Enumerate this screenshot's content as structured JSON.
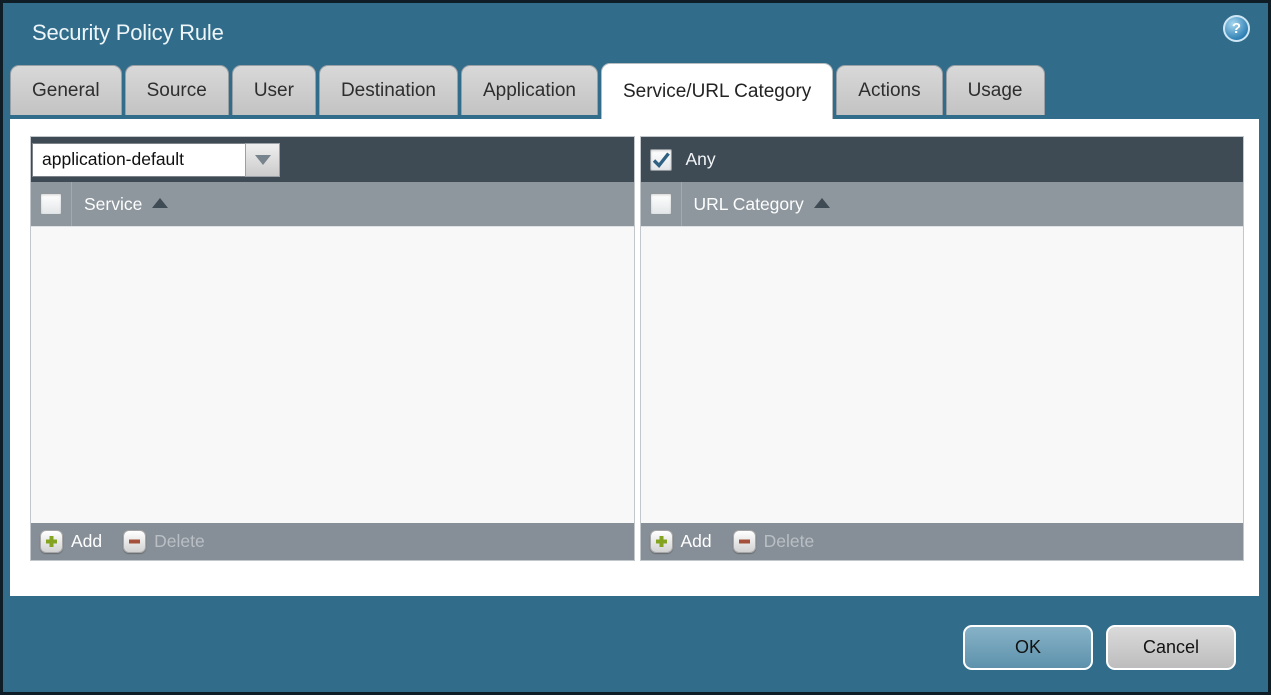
{
  "window": {
    "title": "Security Policy Rule",
    "help_glyph": "?"
  },
  "tabs": [
    {
      "label": "General",
      "active": false
    },
    {
      "label": "Source",
      "active": false
    },
    {
      "label": "User",
      "active": false
    },
    {
      "label": "Destination",
      "active": false
    },
    {
      "label": "Application",
      "active": false
    },
    {
      "label": "Service/URL Category",
      "active": true
    },
    {
      "label": "Actions",
      "active": false
    },
    {
      "label": "Usage",
      "active": false
    }
  ],
  "service_panel": {
    "dropdown_value": "application-default",
    "column_header": "Service",
    "rows": [],
    "header_checkbox_checked": false,
    "add_label": "Add",
    "delete_label": "Delete",
    "delete_enabled": false
  },
  "url_category_panel": {
    "any_label": "Any",
    "any_checked": true,
    "column_header": "URL Category",
    "rows": [],
    "header_checkbox_checked": false,
    "add_label": "Add",
    "delete_label": "Delete",
    "delete_enabled": false
  },
  "dialog_buttons": {
    "ok_label": "OK",
    "cancel_label": "Cancel"
  },
  "colors": {
    "window_background": "#316d8b",
    "window_border": "#0e1d26",
    "panel_header_dark": "#3e4a54",
    "column_header_gray": "#8e969e",
    "panel_footer_gray": "#868f97",
    "list_background": "#f8f8f8",
    "active_tab": "#ffffff",
    "inactive_tab": "#c9c9c9",
    "ok_button": "#6fa3bd",
    "cancel_button": "#cccccc",
    "add_plus_green": "#84a421",
    "delete_minus_red": "#a5503a",
    "checkmark_blue": "#2f6183"
  }
}
